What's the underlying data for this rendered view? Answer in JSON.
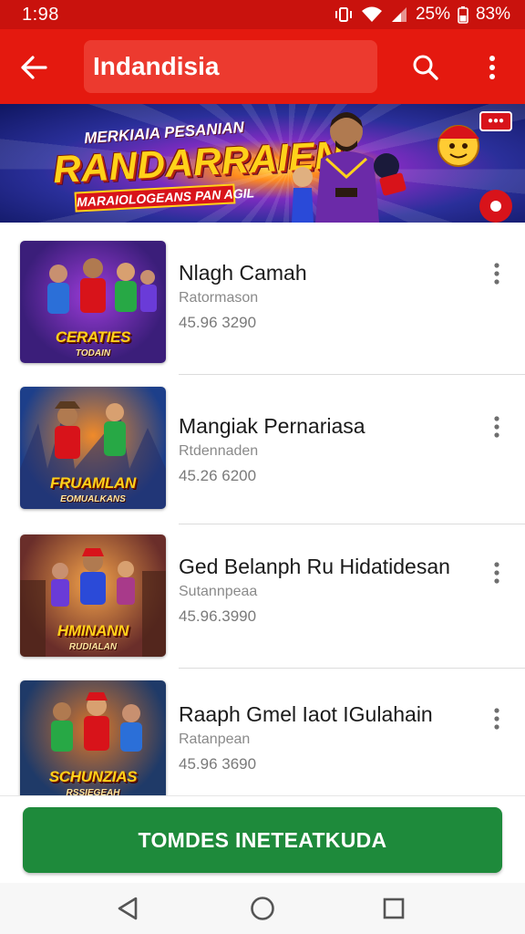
{
  "status_bar": {
    "time": "1:98",
    "battery_text": "25%",
    "signal_text": "83%",
    "icons": [
      "vibrate-icon",
      "wifi-icon",
      "cell-signal-icon"
    ]
  },
  "app_bar": {
    "title": "Indandisia",
    "icons": [
      "back-arrow-icon",
      "search-icon",
      "more-vert-icon"
    ]
  },
  "banner": {
    "subtitle": "MERKIAIA PESANIAN",
    "title": "RANDARRAIEN",
    "tagline": "MARAIOLOGEANS PAN AGIL"
  },
  "list": {
    "items": [
      {
        "name": "Nlagh Camah",
        "subtitle": "Ratormason",
        "meta": "45.96 3290",
        "thumb_title": "CERATIES",
        "thumb_subtitle": "TODAIN",
        "thumb_colors": [
          "#3b1e7a",
          "#9b3bd8"
        ]
      },
      {
        "name": "Mangiak Pernariasa",
        "subtitle": "Rtdennaden",
        "meta": "45.26 6200",
        "thumb_title": "FRUAMLAN",
        "thumb_subtitle": "EOMUALKANS",
        "thumb_colors": [
          "#1d3f8a",
          "#f08a2a"
        ]
      },
      {
        "name": "Ged Belanph Ru Hidatidesan",
        "subtitle": "Sutannpeaa",
        "meta": "45.96.3990",
        "thumb_title": "HMINANN",
        "thumb_subtitle": "RUDIALAN",
        "thumb_colors": [
          "#6a2e2a",
          "#f3a24a"
        ]
      },
      {
        "name": "Raaph Gmel Iaot IGulahain",
        "subtitle": "Ratanpean",
        "meta": "45.96 3690",
        "thumb_title": "SCHUNZIAS",
        "thumb_subtitle": "RSSIEGEAH",
        "thumb_colors": [
          "#1f3a68",
          "#d9762a"
        ]
      }
    ]
  },
  "cta": {
    "label": "TOMDES INETEATKUDA",
    "color": "#1e8a3b"
  },
  "nav_bar": {
    "icons": [
      "nav-back-icon",
      "nav-home-icon",
      "nav-recents-icon"
    ]
  },
  "colors": {
    "status_bar": "#c9120d",
    "app_bar": "#e4190f",
    "accent_green": "#1e8a3b"
  }
}
